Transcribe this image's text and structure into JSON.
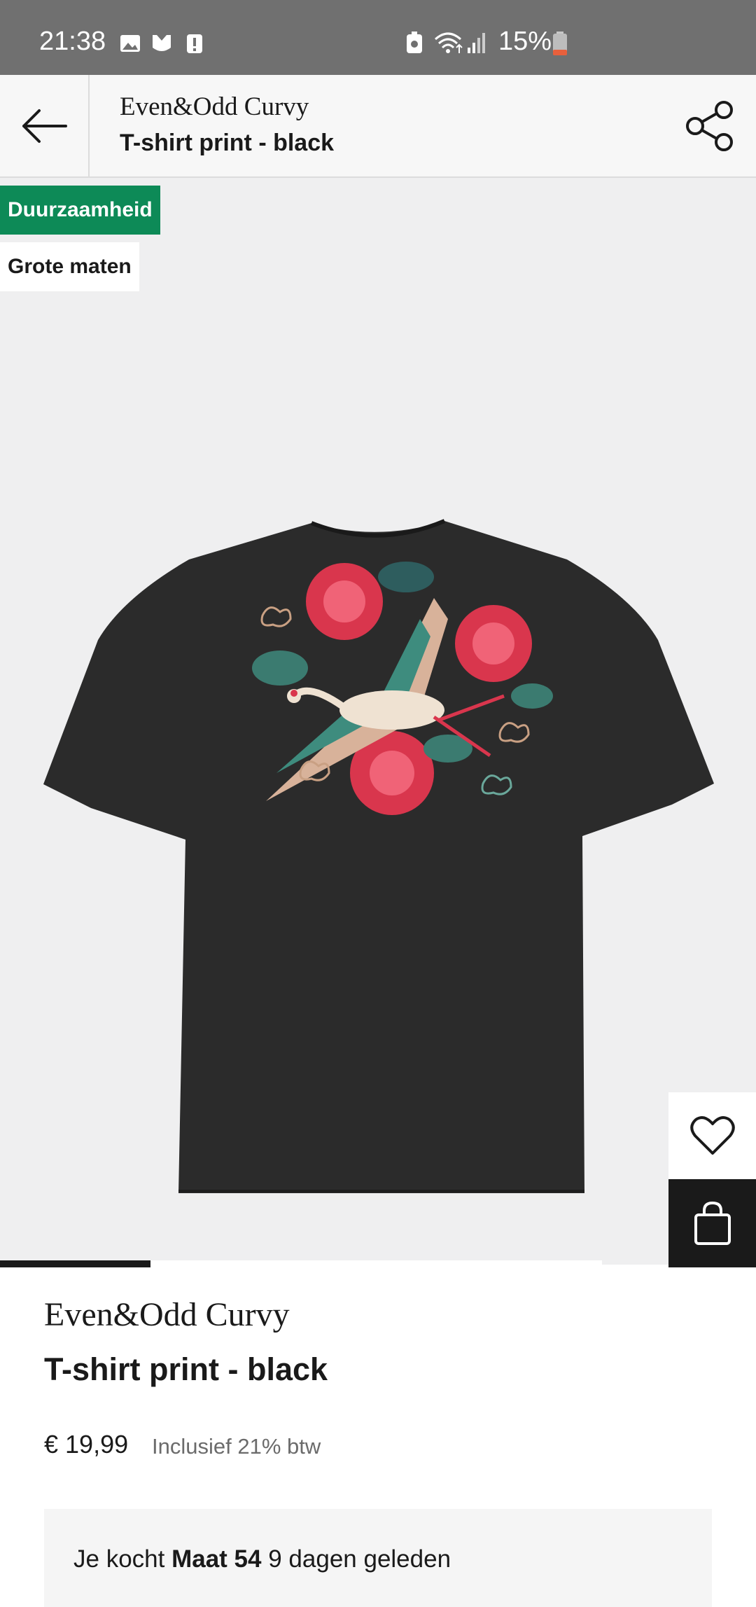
{
  "status_bar": {
    "time": "21:38",
    "battery": "15%"
  },
  "header": {
    "brand": "Even&Odd Curvy",
    "title": "T-shirt print - black"
  },
  "badges": [
    {
      "label": "Duurzaamheid",
      "color": "#0d8a57"
    },
    {
      "label": "Grote maten",
      "color": "#ffffff"
    }
  ],
  "carousel": {
    "current": 1,
    "total": 4
  },
  "product": {
    "brand": "Even&Odd Curvy",
    "title": "T-shirt print - black",
    "price": "€ 19,99",
    "vat_note": "Inclusief 21% btw"
  },
  "purchase_history": {
    "prefix": "Je kocht",
    "size": "Maat 54",
    "suffix": "9 dagen geleden"
  },
  "icons": {
    "back": "arrow-left-icon",
    "share": "share-icon",
    "wishlist": "heart-icon",
    "bag": "shopping-bag-icon"
  }
}
